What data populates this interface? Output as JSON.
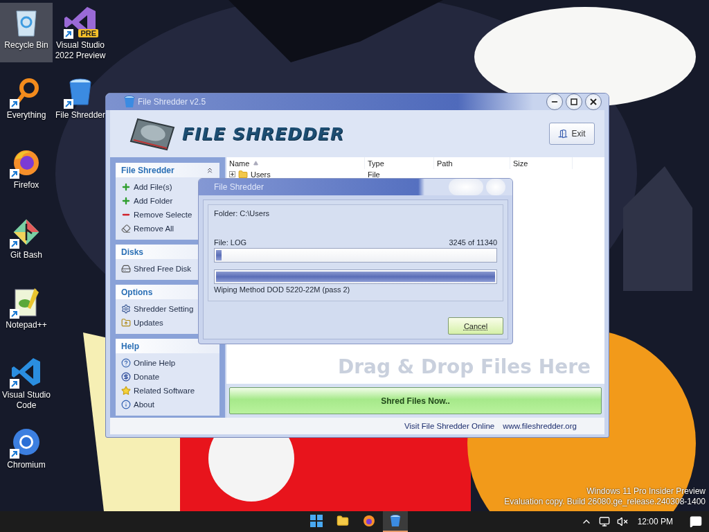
{
  "desktop_icons": [
    {
      "label": "Recycle Bin",
      "kind": "recycle",
      "shortcut": false,
      "selected": true
    },
    {
      "label": "Everything",
      "kind": "everything",
      "shortcut": true,
      "selected": false
    },
    {
      "label": "Firefox",
      "kind": "firefox",
      "shortcut": true,
      "selected": false
    },
    {
      "label": "Git Bash",
      "kind": "git",
      "shortcut": true,
      "selected": false
    },
    {
      "label": "Notepad++",
      "kind": "notepad",
      "shortcut": true,
      "selected": false
    },
    {
      "label": "Visual Studio Code",
      "kind": "vscode",
      "shortcut": true,
      "selected": false
    },
    {
      "label": "Chromium",
      "kind": "chromium",
      "shortcut": true,
      "selected": false
    },
    {
      "label": "Visual Studio 2022 Preview",
      "kind": "vs",
      "badge": "PRE",
      "shortcut": true,
      "selected": false
    },
    {
      "label": "File Shredder",
      "kind": "shredder",
      "shortcut": true,
      "selected": false
    }
  ],
  "window": {
    "title": "File Shredder v2.5",
    "app_name": "FILE SHREDDER",
    "exit_button": "Exit",
    "sidebar": [
      {
        "title": "File Shredder",
        "collapsible": true,
        "items": [
          {
            "label": "Add File(s)",
            "kind": "add"
          },
          {
            "label": "Add Folder",
            "kind": "add"
          },
          {
            "label": "Remove Selecte",
            "kind": "remove"
          },
          {
            "label": "Remove All",
            "kind": "erase"
          }
        ]
      },
      {
        "title": "Disks",
        "collapsible": false,
        "items": [
          {
            "label": "Shred Free Disk",
            "kind": "disk"
          }
        ]
      },
      {
        "title": "Options",
        "collapsible": false,
        "items": [
          {
            "label": "Shredder Setting",
            "kind": "settings"
          },
          {
            "label": "Updates",
            "kind": "update"
          }
        ]
      },
      {
        "title": "Help",
        "collapsible": false,
        "items": [
          {
            "label": "Online Help",
            "kind": "help"
          },
          {
            "label": "Donate",
            "kind": "donate"
          },
          {
            "label": "Related Software",
            "kind": "star"
          },
          {
            "label": "About",
            "kind": "info"
          }
        ]
      }
    ],
    "file_list": {
      "columns": [
        {
          "label": "Name",
          "sorted": true
        },
        {
          "label": "Type",
          "sorted": false
        },
        {
          "label": "Path",
          "sorted": false
        },
        {
          "label": "Size",
          "sorted": false
        }
      ],
      "rows": [
        {
          "name": "Users",
          "type": "File",
          "expanded": false
        }
      ]
    },
    "drop_hint": "Drag & Drop Files Here",
    "shred_button": "Shred Files Now..",
    "status_bar": {
      "link": "Visit File Shredder Online",
      "url": "www.fileshredder.org"
    }
  },
  "dialog": {
    "title": "File Shredder",
    "folder": "Folder: C:\\Users",
    "file": "File: LOG",
    "count": "3245 of 11340",
    "file_progress": {
      "level": 0.02
    },
    "total_progress": {
      "level": 1
    },
    "method": "Wiping Method DOD 5220-22M (pass 2)",
    "cancel_button": "Cancel"
  },
  "os_notice": [
    "Windows 11 Pro Insider Preview",
    "Evaluation copy. Build 26080.ge_release.240308-1400"
  ],
  "taskbar": {
    "apps": [
      {
        "kind": "start",
        "selected": false
      },
      {
        "kind": "explorer",
        "selected": false
      },
      {
        "kind": "firefox",
        "selected": false
      },
      {
        "kind": "shredder",
        "selected": true
      }
    ],
    "clock": "12:00 PM"
  }
}
